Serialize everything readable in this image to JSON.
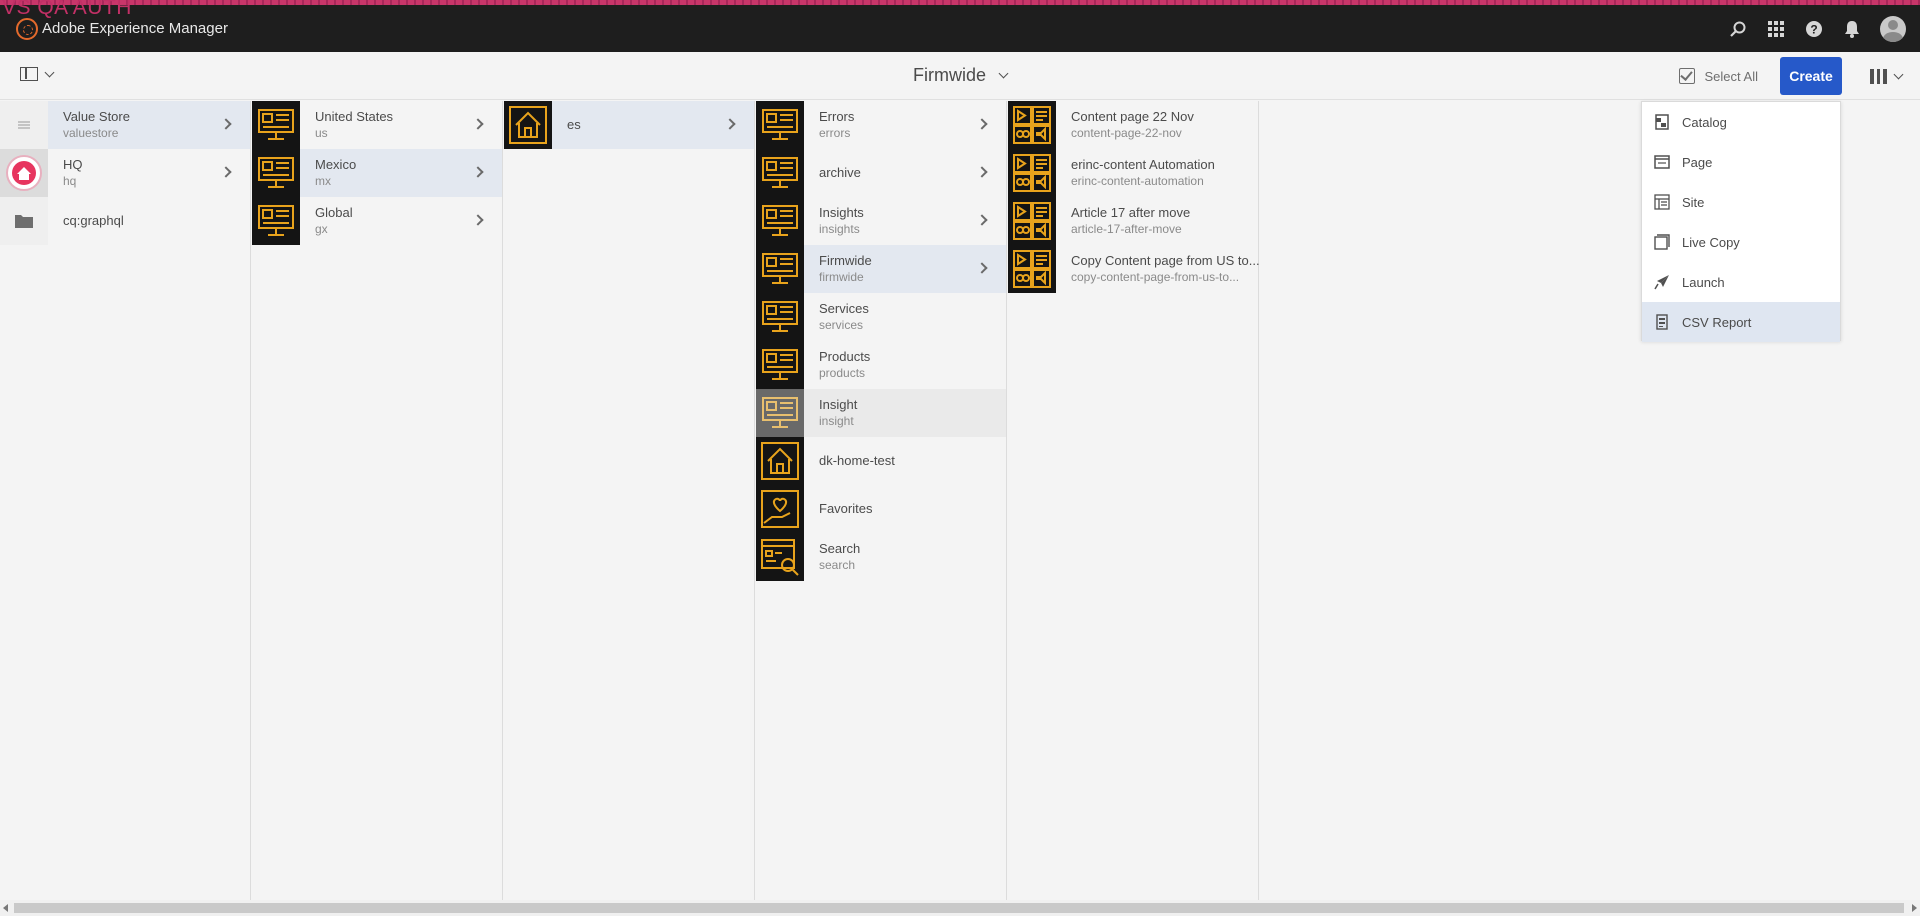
{
  "env_label": "VS QA AUTH",
  "topbar": {
    "app_name": "Adobe Experience Manager"
  },
  "actionbar": {
    "title": "Firmwide",
    "select_all": "Select All",
    "create": "Create"
  },
  "columns": [
    {
      "items": [
        {
          "title": "Value Store",
          "subtitle": "valuestore",
          "icon": "lines-icon",
          "selected": true,
          "arrow": true
        },
        {
          "title": "HQ",
          "subtitle": "hq",
          "icon": "home-badge-icon",
          "selected": false,
          "arrow": true
        },
        {
          "title": "cq:graphql",
          "subtitle": "",
          "icon": "folder-icon",
          "selected": false,
          "arrow": false
        }
      ]
    },
    {
      "items": [
        {
          "title": "United States",
          "subtitle": "us",
          "icon": "monitor-icon",
          "selected": false,
          "arrow": true
        },
        {
          "title": "Mexico",
          "subtitle": "mx",
          "icon": "monitor-icon",
          "selected": true,
          "arrow": true
        },
        {
          "title": "Global",
          "subtitle": "gx",
          "icon": "monitor-icon",
          "selected": false,
          "arrow": true
        }
      ]
    },
    {
      "items": [
        {
          "title": "es",
          "subtitle": "",
          "icon": "home-icon",
          "selected": true,
          "arrow": true
        }
      ]
    },
    {
      "items": [
        {
          "title": "Errors",
          "subtitle": "errors",
          "icon": "monitor-icon",
          "selected": false,
          "arrow": true
        },
        {
          "title": "archive",
          "subtitle": "",
          "icon": "monitor-icon",
          "selected": false,
          "arrow": true
        },
        {
          "title": "Insights",
          "subtitle": "insights",
          "icon": "monitor-icon",
          "selected": false,
          "arrow": true
        },
        {
          "title": "Firmwide",
          "subtitle": "firmwide",
          "icon": "monitor-icon",
          "selected": true,
          "arrow": true
        },
        {
          "title": "Services",
          "subtitle": "services",
          "icon": "monitor-icon",
          "selected": false,
          "arrow": false
        },
        {
          "title": "Products",
          "subtitle": "products",
          "icon": "monitor-icon",
          "selected": false,
          "arrow": false
        },
        {
          "title": "Insight",
          "subtitle": "insight",
          "icon": "monitor-icon",
          "selected": false,
          "arrow": false,
          "hover": true
        },
        {
          "title": "dk-home-test",
          "subtitle": "",
          "icon": "home-icon",
          "selected": false,
          "arrow": false
        },
        {
          "title": "Favorites",
          "subtitle": "",
          "icon": "heart-hand-icon",
          "selected": false,
          "arrow": false
        },
        {
          "title": "Search",
          "subtitle": "search",
          "icon": "search-page-icon",
          "selected": false,
          "arrow": false
        }
      ]
    },
    {
      "items": [
        {
          "title": "Content page 22 Nov",
          "subtitle": "content-page-22-nov",
          "icon": "media-icon",
          "selected": false,
          "arrow": false
        },
        {
          "title": "erinc-content Automation",
          "subtitle": "erinc-content-automation",
          "icon": "media-icon",
          "selected": false,
          "arrow": false
        },
        {
          "title": "Article 17 after move",
          "subtitle": "article-17-after-move",
          "icon": "media-icon",
          "selected": false,
          "arrow": false
        },
        {
          "title": "Copy Content page from US to...",
          "subtitle": "copy-content-page-from-us-to...",
          "icon": "media-icon",
          "selected": false,
          "arrow": false
        }
      ]
    }
  ],
  "create_menu": [
    {
      "label": "Catalog",
      "icon": "catalog-icon",
      "selected": false
    },
    {
      "label": "Page",
      "icon": "page-icon",
      "selected": false
    },
    {
      "label": "Site",
      "icon": "site-icon",
      "selected": false
    },
    {
      "label": "Live Copy",
      "icon": "live-copy-icon",
      "selected": false
    },
    {
      "label": "Launch",
      "icon": "launch-icon",
      "selected": false
    },
    {
      "label": "CSV Report",
      "icon": "csv-report-icon",
      "selected": true
    }
  ],
  "colors": {
    "accent": "#2659c9",
    "thumb_icon": "#e8a31c",
    "env": "#c23066"
  }
}
